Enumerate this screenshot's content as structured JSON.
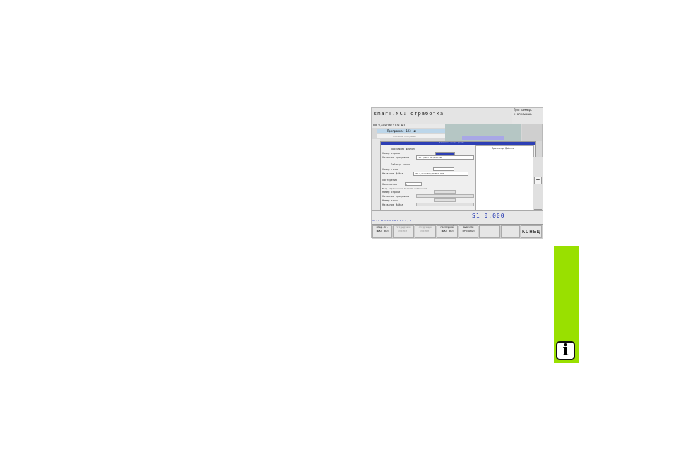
{
  "window": {
    "title": "smarT.NC: отработка",
    "right_box": [
      "Программир.",
      "и вписываю."
    ]
  },
  "tree": {
    "path": "TNC:\\smarTNC\\123.HU",
    "selected": "Программа: 123 мм",
    "item2": "Описание программы"
  },
  "dialog": {
    "title": "Выбирать точки файлы",
    "fields": [
      "Программа шаблон",
      "Номер строки",
      "Название программы",
      "Таблицы точек",
      "Номер точки",
      "Название файла",
      "Повторения",
      "Количество",
      "Ввод ограничения позиции исполнения",
      "Номер строки",
      "Название программы",
      "Номер точки",
      "Название файла"
    ],
    "program_value": "TNC:\\smarTNC\\123.HU",
    "file_value": "TNC:\\smarTNC\\FRAME1.PNT",
    "count_value": "0",
    "preview_label": "Просмотр файлов"
  },
  "status": {
    "s1": "S1   0.000",
    "row2": "ист.  1        10     1  0    0  100     Z  0         M 5 / 8"
  },
  "softkeys": [
    "ПРОД.ПР. ВЫКЛ ВКЛ",
    "ПРЕДЫДУЩИЙ ЭЛЕМЕНТ",
    "СЛЕДУЮЩИЙ ЭЛЕМЕНТ",
    "ПОСЛЕДНИЙ ВЫКЛ ВКЛ",
    "ВЫВЕСТИ ПРОТОКОЛ",
    "",
    "",
    "КОНЕЦ"
  ],
  "right_buttons": [
    "+",
    "−"
  ],
  "info_glyph": "i",
  "colors": {
    "accent_green": "#99e000",
    "selection_blue": "#bcd6ea",
    "status_blue": "#1a2fb0"
  }
}
